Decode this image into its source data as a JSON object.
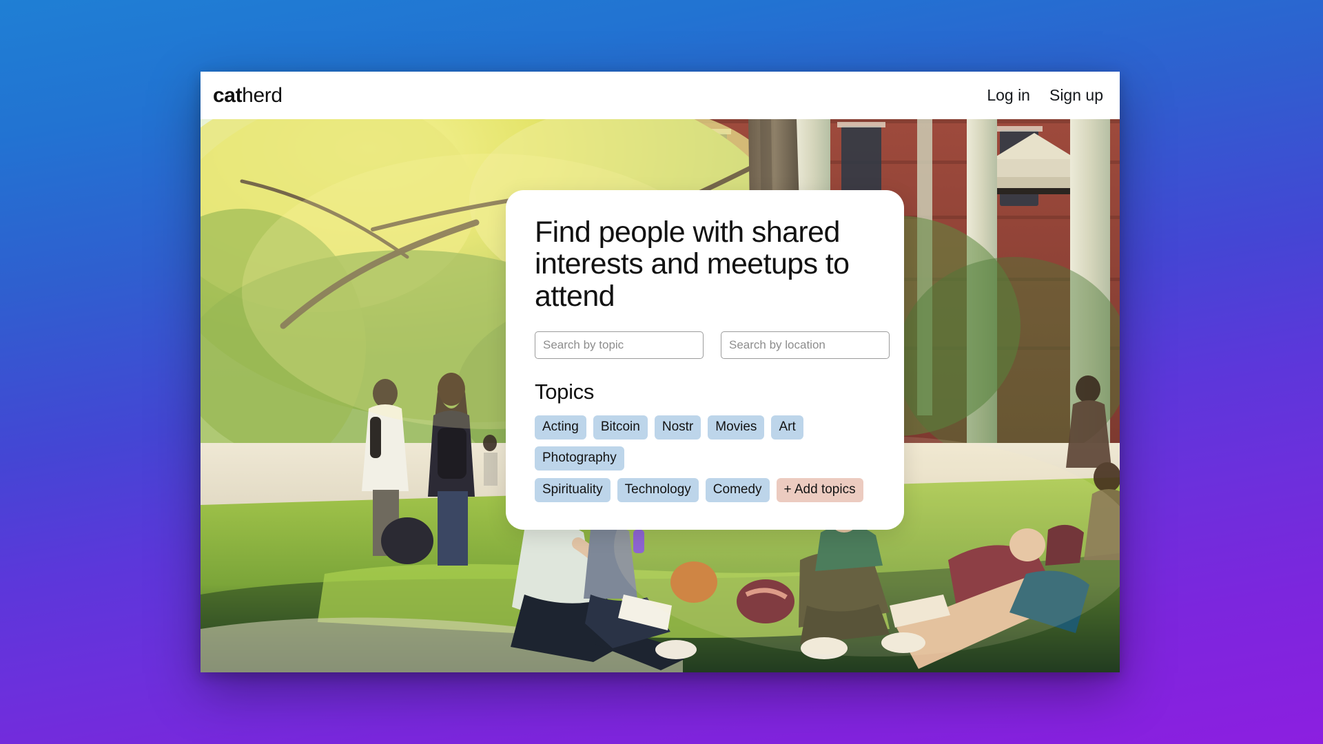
{
  "header": {
    "logo_mark": "cat",
    "logo_rest": "herd",
    "nav": [
      {
        "label": "Log in",
        "name": "login"
      },
      {
        "label": "Sign up",
        "name": "signup"
      }
    ]
  },
  "hero": {
    "card": {
      "headline": "Find people with shared interests and meetups to attend",
      "search": {
        "topic_placeholder": "Search by topic",
        "topic_value": "",
        "location_placeholder": "Search by location",
        "location_value": ""
      },
      "topics_title": "Topics",
      "topic_rows": [
        [
          {
            "label": "Acting",
            "style": "default"
          },
          {
            "label": "Bitcoin",
            "style": "default"
          },
          {
            "label": "Nostr",
            "style": "default"
          },
          {
            "label": "Movies",
            "style": "default"
          },
          {
            "label": "Art",
            "style": "default"
          },
          {
            "label": "Photography",
            "style": "default"
          }
        ],
        [
          {
            "label": "Spirituality",
            "style": "default"
          },
          {
            "label": "Technology",
            "style": "default"
          },
          {
            "label": "Comedy",
            "style": "default"
          },
          {
            "label": "+ Add topics",
            "style": "add"
          }
        ]
      ]
    }
  },
  "colors": {
    "tag_background": "#bdd5ea",
    "tag_add_background": "#eccbc0",
    "page_gradient_top": "#1f7fd4",
    "page_gradient_bottom": "#8c1fe0",
    "card_background": "#ffffff"
  }
}
